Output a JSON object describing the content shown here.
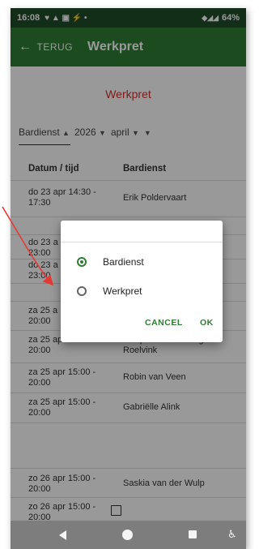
{
  "statusbar": {
    "time": "16:08",
    "left_icons": "♥ ▲ ▣ ⚡ •",
    "right_icons": "◆◢◢",
    "battery": "64%"
  },
  "appbar": {
    "back_label": "TERUG",
    "title": "Werkpret"
  },
  "page": {
    "heading": "Werkpret",
    "filters": {
      "type": "Bardienst",
      "year": "2026",
      "month": "april"
    },
    "columns": {
      "date": "Datum / tijd",
      "duty": "Bardienst"
    }
  },
  "rows": [
    {
      "date": "do 23 apr 14:30 - 17:30",
      "name": "Erik Poldervaart"
    },
    {
      "date": "",
      "name": ""
    },
    {
      "date": "do 23 apr 19:00 - 23:00",
      "name": ""
    },
    {
      "date": "do 23 apr 19:00 - 23:00",
      "name": ""
    },
    {
      "date": "",
      "name": ""
    },
    {
      "date": "za 25 apr 15:00 - 20:00",
      "name": ""
    },
    {
      "date": "za 25 apr 15:00 - 20:00",
      "name": "Jacqueline van Krugten-Roelvink"
    },
    {
      "date": "za 25 apr 15:00 - 20:00",
      "name": "Robin van Veen"
    },
    {
      "date": "za 25 apr 15:00 - 20:00",
      "name": "Gabriëlle Alink"
    },
    {
      "date": "",
      "name": ""
    },
    {
      "date": "zo 26 apr 15:00 - 20:00",
      "name": "Saskia van der Wulp"
    },
    {
      "date": "zo 26 apr 15:00 - 20:00",
      "name": ""
    }
  ],
  "visible_row_text": {
    "r0c1": "do 23 apr 14:30 - 17:30",
    "r2c1": "do 23 a\n23:00",
    "r3c1": "do 23 a\n23:00",
    "r5c1": "za 25 a\n20:00"
  },
  "dialog": {
    "options": [
      {
        "label": "Bardienst",
        "selected": true
      },
      {
        "label": "Werkpret",
        "selected": false
      }
    ],
    "cancel": "CANCEL",
    "ok": "OK"
  },
  "colors": {
    "statusbar": "#1e4d2b",
    "appbar": "#2e7d32",
    "accent": "#2e7d32",
    "heading": "#d32f2f",
    "annotation": "#e53935"
  },
  "icons": {
    "back": "arrow-left-icon",
    "nav_back": "triangle-back-icon",
    "nav_home": "circle-home-icon",
    "nav_recent": "square-recent-icon",
    "accessibility": "accessibility-icon"
  }
}
